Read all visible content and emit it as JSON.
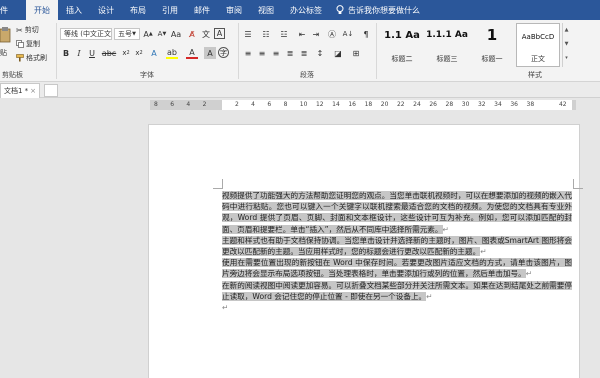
{
  "menubar": {
    "tabs": [
      "件",
      "开始",
      "插入",
      "设计",
      "布局",
      "引用",
      "邮件",
      "审阅",
      "视图",
      "办公标签"
    ],
    "active_index": 1,
    "tell_me": "告诉我你想要做什么"
  },
  "ribbon": {
    "clipboard": {
      "paste_label": "贴",
      "cut_label": "剪切",
      "copy_label": "复制",
      "format_painter_label": "格式刷",
      "group_label": "剪贴板"
    },
    "font": {
      "font_name": "等线 (中文正文",
      "font_size": "五号",
      "group_label": "字体"
    },
    "paragraph": {
      "group_label": "段落"
    },
    "styles": {
      "items": [
        {
          "sample": "1.1  Aa",
          "name": "标题二"
        },
        {
          "sample": "1.1.1  Aa",
          "name": "标题三"
        },
        {
          "sample": "1",
          "name": "标题一"
        },
        {
          "sample": "AaBbCcD",
          "name": "正文"
        }
      ],
      "group_label": "样式"
    }
  },
  "tabbar": {
    "doc_tab_label": "文档1 *",
    "close_glyph": "×"
  },
  "ruler": {
    "numbers": [
      "8",
      "6",
      "4",
      "2",
      "",
      "2",
      "4",
      "6",
      "8",
      "10",
      "12",
      "14",
      "16",
      "18",
      "20",
      "22",
      "24",
      "26",
      "28",
      "30",
      "32",
      "34",
      "36",
      "38",
      "",
      "42"
    ]
  },
  "document": {
    "paragraphs": [
      "视频提供了功能强大的方法帮助您证明您的观点。当您单击联机视频时，可以在想要添加的视频的嵌入代码中进行粘贴。您也可以键入一个关键字以联机搜索最适合您的文档的视频。为使您的文档具有专业外观，Word 提供了页眉、页脚、封面和文本框设计，这些设计可互为补充。例如，您可以添加匹配的封面、页眉和提要栏。单击“插入”，然后从不同库中选择所需元素。",
      "主题和样式也有助于文档保持协调。当您单击设计并选择新的主题时，图片、图表或SmartArt 图形将会更改以匹配新的主题。当应用样式时，您的标题会进行更改以匹配新的主题。",
      "使用在需要位置出现的新按钮在 Word 中保存时间。若要更改图片适应文档的方式，请单击该图片，图片旁边将会显示布局选项按钮。当处理表格时，单击要添加行或列的位置，然后单击加号。",
      "在新的阅读视图中阅读更加容易。可以折叠文档某些部分并关注所需文本。如果在达到结尾处之前需要停止读取，Word 会记住您的停止位置 - 即使在另一个设备上。"
    ],
    "paragraph_mark": "↵"
  },
  "colors": {
    "accent": "#2b579a",
    "highlight": "#c6c6c6"
  }
}
